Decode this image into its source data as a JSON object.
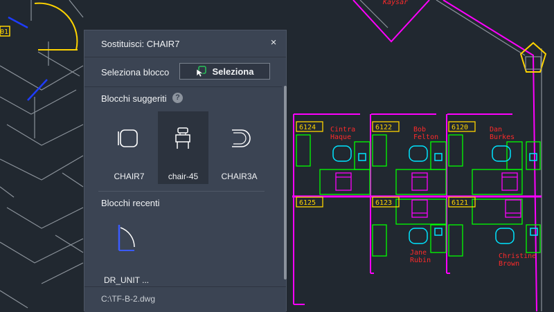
{
  "dialog": {
    "title": "Sostituisci: CHAIR7",
    "close_glyph": "×",
    "select_block_label": "Seleziona blocco",
    "select_button_label": "Seleziona",
    "suggested_title": "Blocchi suggeriti",
    "help_glyph": "?",
    "suggested_blocks": [
      {
        "name": "CHAIR7",
        "icon": "chair7-block-icon"
      },
      {
        "name": "chair-45",
        "icon": "chair-45-block-icon",
        "selected": true
      },
      {
        "name": "CHAIR3A",
        "icon": "chair3a-block-icon"
      }
    ],
    "recent_title": "Blocchi recenti",
    "recent_blocks": [
      {
        "name": "DR_UNIT ...",
        "icon": "door-unit-block-icon"
      }
    ],
    "file_path": "C:\\TF-B-2.dwg"
  },
  "drawing": {
    "rooms": [
      {
        "number": "6124",
        "occupant": [
          "Cintra",
          "Haque"
        ]
      },
      {
        "number": "6122",
        "occupant": [
          "Bob",
          "Felton"
        ]
      },
      {
        "number": "6120",
        "occupant": [
          "Dan",
          "Burkes"
        ]
      },
      {
        "number": "6125",
        "occupant": []
      },
      {
        "number": "6123",
        "occupant": [
          "Jane",
          "Rubin"
        ]
      },
      {
        "number": "6121",
        "occupant": [
          "Christine",
          "Brown"
        ]
      }
    ],
    "top_name": "Kaysar",
    "left_tag": "01",
    "colors": {
      "background": "#212830",
      "walls": "#ff00ff",
      "furniture": "#00ff00",
      "chairs": "#00e5ff",
      "labels": "#ff2a2a",
      "room_tags": "#ffd400",
      "structure": "#8c939b"
    }
  }
}
